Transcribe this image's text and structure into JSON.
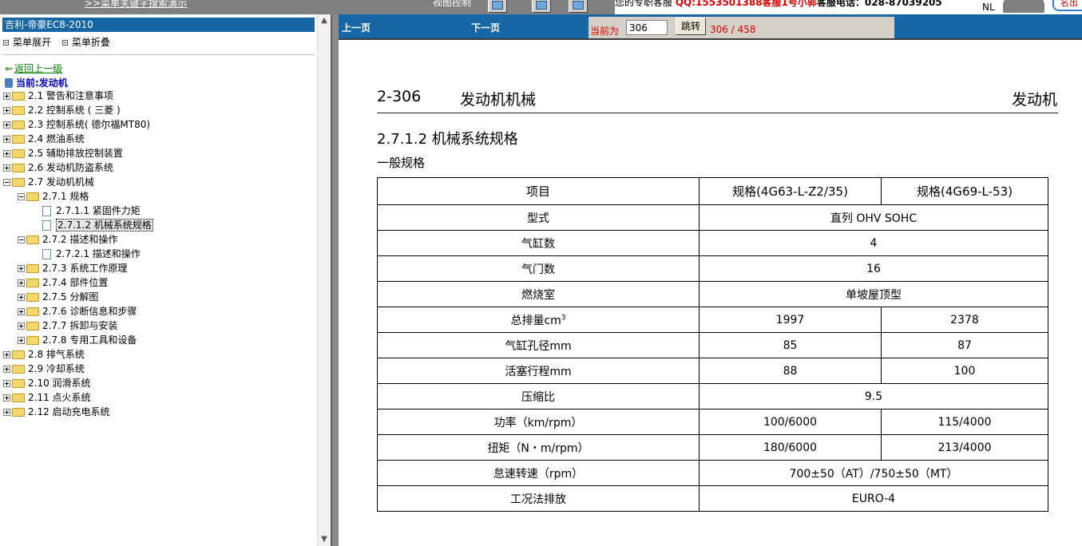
{
  "topbar": {
    "banner_link": ">>菜单关键字搜索演示",
    "nav_label": "视图控制",
    "contact_prefix": "您的专职客服",
    "qq": "QQ:1553501388",
    "service": "客服1号小郭",
    "phone_label": "客服电话：",
    "phone": "028-87039205",
    "logo_text": "NL",
    "logo_pill": "名出"
  },
  "left": {
    "title": "吉利-帝豪EC8-2010",
    "expand_label": "菜单展开",
    "collapse_label": "菜单折叠",
    "back_label": "返回上一级",
    "current_label": "当前:发动机",
    "tree": [
      {
        "label": "2.1 警告和注意事项",
        "level": 0,
        "type": "folder",
        "expanded": false
      },
      {
        "label": "2.2 控制系统 ( 三菱 )",
        "level": 0,
        "type": "folder",
        "expanded": false
      },
      {
        "label": "2.3 控制系统( 德尔福MT80)",
        "level": 0,
        "type": "folder",
        "expanded": false
      },
      {
        "label": "2.4 燃油系统",
        "level": 0,
        "type": "folder",
        "expanded": false
      },
      {
        "label": "2.5 辅助排放控制装置",
        "level": 0,
        "type": "folder",
        "expanded": false
      },
      {
        "label": "2.6 发动机防盗系统",
        "level": 0,
        "type": "folder",
        "expanded": false
      },
      {
        "label": "2.7 发动机机械",
        "level": 0,
        "type": "folder",
        "expanded": true
      },
      {
        "label": "2.7.1 规格",
        "level": 1,
        "type": "folder",
        "expanded": true
      },
      {
        "label": "2.7.1.1 紧固件力矩",
        "level": 2,
        "type": "doc"
      },
      {
        "label": "2.7.1.2 机械系统规格",
        "level": 2,
        "type": "doc",
        "selected": true
      },
      {
        "label": "2.7.2 描述和操作",
        "level": 1,
        "type": "folder",
        "expanded": true
      },
      {
        "label": "2.7.2.1 描述和操作",
        "level": 2,
        "type": "doc"
      },
      {
        "label": "2.7.3 系统工作原理",
        "level": 1,
        "type": "folder",
        "expanded": false
      },
      {
        "label": "2.7.4 部件位置",
        "level": 1,
        "type": "folder",
        "expanded": false
      },
      {
        "label": "2.7.5 分解图",
        "level": 1,
        "type": "folder",
        "expanded": false
      },
      {
        "label": "2.7.6 诊断信息和步骤",
        "level": 1,
        "type": "folder",
        "expanded": false
      },
      {
        "label": "2.7.7 拆卸与安装",
        "level": 1,
        "type": "folder",
        "expanded": false
      },
      {
        "label": "2.7.8 专用工具和设备",
        "level": 1,
        "type": "folder",
        "expanded": false
      },
      {
        "label": "2.8 排气系统",
        "level": 0,
        "type": "folder",
        "expanded": false
      },
      {
        "label": "2.9 冷却系统",
        "level": 0,
        "type": "folder",
        "expanded": false
      },
      {
        "label": "2.10 润滑系统",
        "level": 0,
        "type": "folder",
        "expanded": false
      },
      {
        "label": "2.11 点火系统",
        "level": 0,
        "type": "folder",
        "expanded": false
      },
      {
        "label": "2.12 启动充电系统",
        "level": 0,
        "type": "folder",
        "expanded": false
      }
    ]
  },
  "nav": {
    "prev": "上一页",
    "next": "下一页",
    "current_label": "当前为",
    "page_value": "306",
    "jump": "跳转",
    "pages": "306 / 458"
  },
  "doc": {
    "page_no": "2-306",
    "chapter": "发动机机械",
    "chapter_right": "发动机",
    "section_title": "2.7.1.2 机械系统规格",
    "sub_title": "一般规格",
    "table": {
      "headers": [
        "项目",
        "规格(4G63-L-Z2/35)",
        "规格(4G69-L-53)"
      ],
      "rows": [
        {
          "item": "型式",
          "merged": "直列 OHV SOHC"
        },
        {
          "item": "气缸数",
          "merged": "4"
        },
        {
          "item": "气门数",
          "merged": "16"
        },
        {
          "item": "燃烧室",
          "merged": "单坡屋顶型"
        },
        {
          "item": "总排量cm",
          "sup": "3",
          "a": "1997",
          "b": "2378"
        },
        {
          "item": "气缸孔径mm",
          "a": "85",
          "b": "87"
        },
        {
          "item": "活塞行程mm",
          "a": "88",
          "b": "100"
        },
        {
          "item": "压缩比",
          "merged": "9.5"
        },
        {
          "item": "功率（km/rpm）",
          "a": "100/6000",
          "b": "115/4000"
        },
        {
          "item": "扭矩（N・m/rpm）",
          "a": "180/6000",
          "b": "213/4000"
        },
        {
          "item": "怠速转速（rpm）",
          "merged": "700±50（AT）/750±50（MT）"
        },
        {
          "item": "工况法排放",
          "merged": "EURO-4"
        }
      ]
    }
  }
}
